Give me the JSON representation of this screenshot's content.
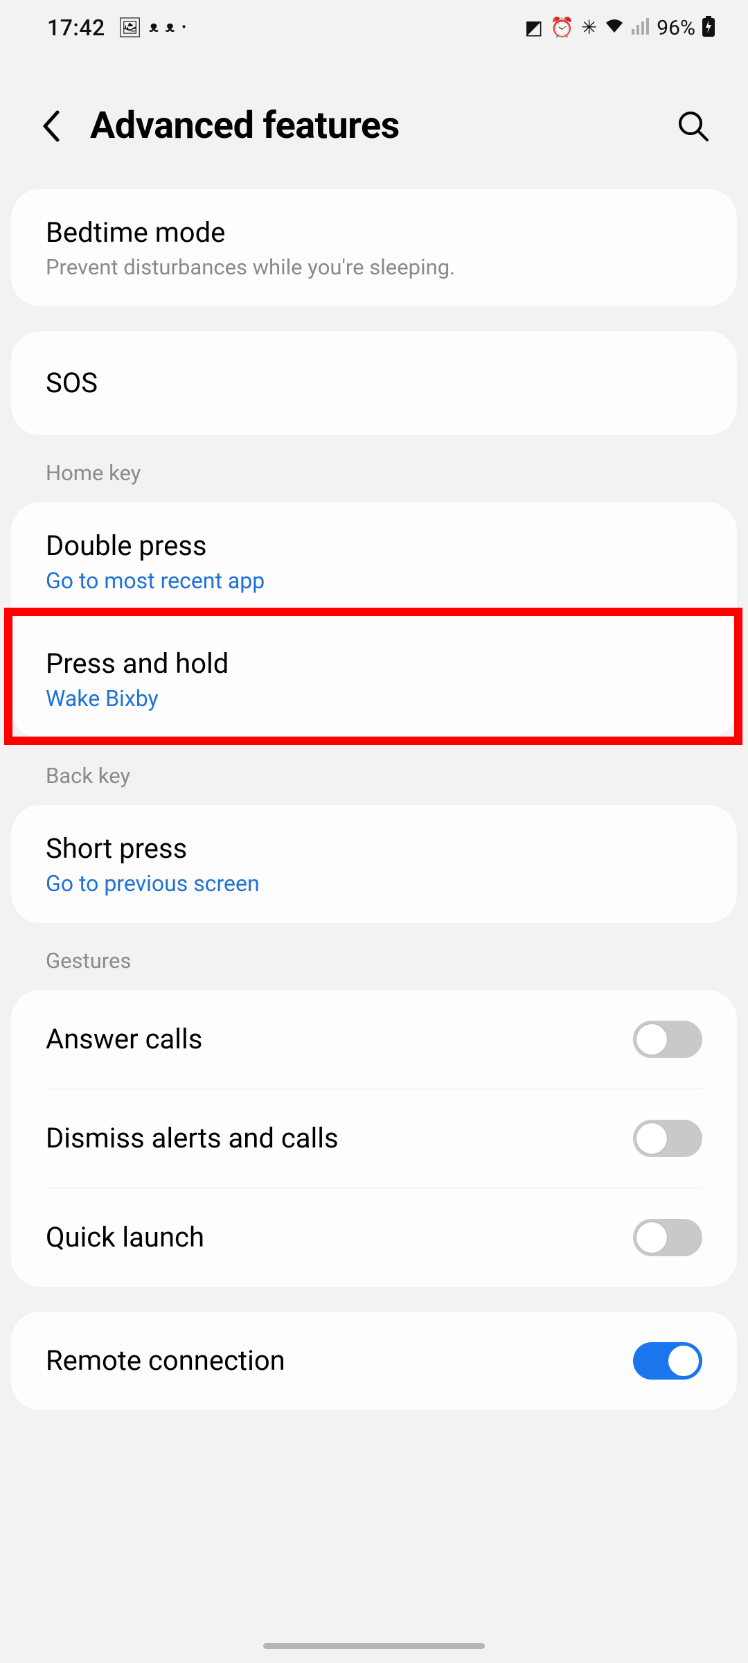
{
  "status": {
    "time": "17:42",
    "battery_percent": "96%",
    "icons_left": [
      "image-icon",
      "teams-icon",
      "teams-icon",
      "dot-icon"
    ],
    "icons_right": [
      "power-save-icon",
      "alarm-icon",
      "bluetooth-icon",
      "wifi-icon",
      "signal-icon"
    ]
  },
  "header": {
    "title": "Advanced features"
  },
  "rows": {
    "bedtime": {
      "title": "Bedtime mode",
      "sub": "Prevent disturbances while you're sleeping."
    },
    "sos": {
      "title": "SOS"
    }
  },
  "sections": {
    "homekey": "Home key",
    "backkey": "Back key",
    "gestures": "Gestures"
  },
  "homekey": {
    "double_press": {
      "title": "Double press",
      "sub": "Go to most recent app"
    },
    "press_hold": {
      "title": "Press and hold",
      "sub": "Wake Bixby"
    }
  },
  "backkey": {
    "short_press": {
      "title": "Short press",
      "sub": "Go to previous screen"
    }
  },
  "gestures": {
    "answer_calls": {
      "title": "Answer calls",
      "state": "off"
    },
    "dismiss_alerts": {
      "title": "Dismiss alerts and calls",
      "state": "off"
    },
    "quick_launch": {
      "title": "Quick launch",
      "state": "off"
    }
  },
  "remote": {
    "title": "Remote connection",
    "state": "on"
  },
  "highlight": {
    "target": "press-and-hold-row"
  }
}
